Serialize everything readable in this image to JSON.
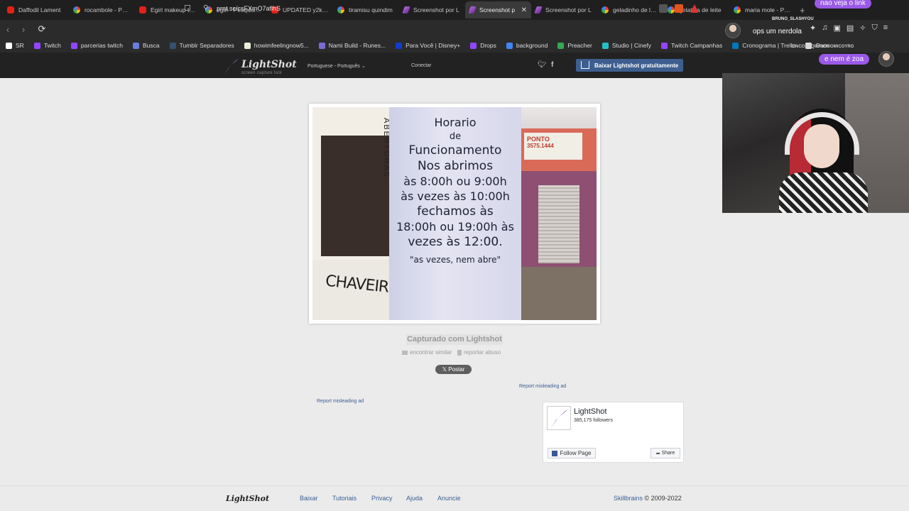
{
  "browser": {
    "tabs": [
      {
        "label": "Daffodil Lament",
        "icon": "yt"
      },
      {
        "label": "rocambole - Pesq",
        "icon": "g"
      },
      {
        "label": "Egirl makeup trad",
        "icon": "yt"
      },
      {
        "label": "egirl - Pesquisa G",
        "icon": "g"
      },
      {
        "label": "UPDATED y2k alt",
        "icon": "yt"
      },
      {
        "label": "tiramisu quindim",
        "icon": "g"
      },
      {
        "label": "Screenshot por L",
        "icon": "ls"
      },
      {
        "label": "Screenshot p",
        "icon": "ls",
        "active": true
      },
      {
        "label": "Screenshot por L",
        "icon": "ls"
      },
      {
        "label": "geladinho de leite",
        "icon": "g"
      },
      {
        "label": "gelatina de leite",
        "icon": "g"
      },
      {
        "label": "maria mole - Pesq",
        "icon": "g"
      }
    ],
    "url": "prnt.sc/csFXmO7aflhS",
    "bookmarks": [
      {
        "label": "SR",
        "color": "#ffffff"
      },
      {
        "label": "Twitch",
        "color": "#9146ff"
      },
      {
        "label": "parcerias twitch",
        "color": "#9146ff"
      },
      {
        "label": "Busca",
        "color": "#6a7de0"
      },
      {
        "label": "Tumblr Separadores",
        "color": "#34526f"
      },
      {
        "label": "howimfeelingnow5...",
        "color": "#e8f0d8"
      },
      {
        "label": "Nami Build - Runes...",
        "color": "#7a6bd6"
      },
      {
        "label": "Para Você | Disney+",
        "color": "#113ccf"
      },
      {
        "label": "Drops",
        "color": "#9146ff"
      },
      {
        "label": "background",
        "color": "#4285f4"
      },
      {
        "label": "Preacher",
        "color": "#34a853"
      },
      {
        "label": "Studio | Cinefy",
        "color": "#24c0c4"
      },
      {
        "label": "Twitch Campanhas",
        "color": "#9146ff"
      },
      {
        "label": "Cronograma | Trello",
        "color": "#0079bf"
      },
      {
        "label": "Gam",
        "color": "#dddddd"
      }
    ]
  },
  "lightshot": {
    "logo": "LightShot",
    "logo_sub": "screen capture tool",
    "language": "Portuguese - Português",
    "connect": "Conectar",
    "download": "Baixar Lightshot gratuitamente",
    "captured": "Capturado com Lightshot",
    "find_similar": "encontrar similar",
    "report_abuse": "reportar abuso",
    "post": "Postar",
    "report_ad_1": "Report misleading ad",
    "report_ad_2": "Report misleading ad",
    "facebook": {
      "name": "LightShot",
      "followers": "385,175 followers",
      "follow": "Follow Page",
      "share": "Share"
    },
    "footer": {
      "logo": "LightShot",
      "links": [
        "Baixar",
        "Tutoriais",
        "Privacy",
        "Ajuda",
        "Anuncie"
      ],
      "company": "Skillbrains",
      "copyright": "© 2009-2022"
    }
  },
  "screenshot_image": {
    "sign_lines": [
      "Horario",
      "de",
      "Funcionamento",
      "Nos abrimos",
      "às 8:00h ou 9:00h",
      "às vezes às 10:00h",
      "fechamos às",
      "18:00h ou 19:00h às",
      "vezes às 12:00.",
      "\"as vezes, nem abre\""
    ],
    "vertical_text": "ABERTURAS",
    "booth_text": "CHAVEIRO",
    "shop_sign": "PONTO",
    "shop_phone": "3575.1444"
  },
  "stream_overlay": {
    "chat_top": "nao veja o link",
    "chat_user": "BRUNO_SLASHYOU",
    "chat_msg": "ops um nerdola",
    "chat_user2": "CINCOSOQUIRICHIOMICOYRO",
    "chat_bottom": "e nem é zoa"
  }
}
